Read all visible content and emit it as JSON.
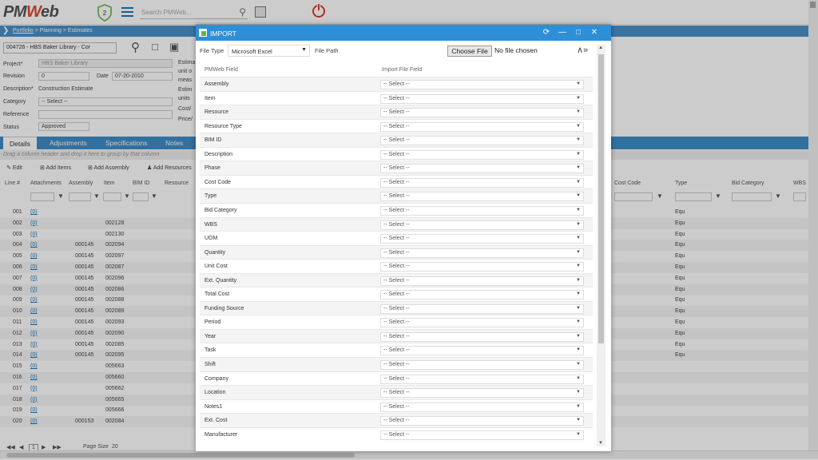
{
  "topbar": {
    "logo_text": "PMWeb",
    "shield_count": "2",
    "search_placeholder": "Search PMWeb..."
  },
  "breadcrumb": {
    "root": "Portfolio",
    "rest": " > Planning > Estimates"
  },
  "record": {
    "selector": "004726 - HBS Baker Library - Cor",
    "fields": [
      {
        "label": "Project*",
        "value": "HBS Baker Library"
      },
      {
        "label": "Revision",
        "value": "0"
      },
      {
        "label": "Date",
        "value": "07-20-2010"
      },
      {
        "label": "Description*",
        "value": "Construction Estimate"
      },
      {
        "label": "Category",
        "value": "-- Select --"
      },
      {
        "label": "Reference",
        "value": ""
      },
      {
        "label": "Status",
        "value": "Approved"
      }
    ],
    "estimate_labels": [
      "Estima",
      "unit o",
      "meas",
      "Estim",
      "units",
      "Cost/",
      "Price/"
    ]
  },
  "tabs": [
    "Details",
    "Adjustments",
    "Specifications",
    "Notes"
  ],
  "group_hint": "Drag a column header and drop it here to group by that column",
  "toolbar": [
    "Edit",
    "Add Items",
    "Add Assembly",
    "Add Resources"
  ],
  "grid": {
    "columns_left": [
      "Line #",
      "Attachments",
      "Assembly",
      "Item",
      "BIM ID",
      "Resource"
    ],
    "columns_right": [
      "Cost Code",
      "Type",
      "Bid Category",
      "WBS"
    ],
    "rows": [
      {
        "line": "001",
        "att": "(0)",
        "asm": "",
        "item": "",
        "type": "Equ"
      },
      {
        "line": "002",
        "att": "(0)",
        "asm": "",
        "item": "002128",
        "type": "Equ"
      },
      {
        "line": "003",
        "att": "(0)",
        "asm": "",
        "item": "002130",
        "type": "Equ"
      },
      {
        "line": "004",
        "att": "(0)",
        "asm": "000145",
        "item": "002094",
        "type": "Equ"
      },
      {
        "line": "005",
        "att": "(0)",
        "asm": "000145",
        "item": "002097",
        "type": "Equ"
      },
      {
        "line": "006",
        "att": "(0)",
        "asm": "000145",
        "item": "002087",
        "type": "Equ"
      },
      {
        "line": "007",
        "att": "(0)",
        "asm": "000145",
        "item": "002096",
        "type": "Equ"
      },
      {
        "line": "008",
        "att": "(0)",
        "asm": "000145",
        "item": "002086",
        "type": "Equ"
      },
      {
        "line": "009",
        "att": "(0)",
        "asm": "000145",
        "item": "002088",
        "type": "Equ"
      },
      {
        "line": "010",
        "att": "(0)",
        "asm": "000145",
        "item": "002089",
        "type": "Equ"
      },
      {
        "line": "011",
        "att": "(0)",
        "asm": "000145",
        "item": "002093",
        "type": "Equ"
      },
      {
        "line": "012",
        "att": "(0)",
        "asm": "000145",
        "item": "002090",
        "type": "Equ"
      },
      {
        "line": "013",
        "att": "(0)",
        "asm": "000145",
        "item": "002085",
        "type": "Equ"
      },
      {
        "line": "014",
        "att": "(0)",
        "asm": "000145",
        "item": "002095",
        "type": "Equ"
      },
      {
        "line": "015",
        "att": "(0)",
        "asm": "",
        "item": "005663",
        "type": ""
      },
      {
        "line": "016",
        "att": "(0)",
        "asm": "",
        "item": "005660",
        "type": ""
      },
      {
        "line": "017",
        "att": "(0)",
        "asm": "",
        "item": "005662",
        "type": ""
      },
      {
        "line": "018",
        "att": "(0)",
        "asm": "",
        "item": "005665",
        "type": ""
      },
      {
        "line": "019",
        "att": "(0)",
        "asm": "",
        "item": "005666",
        "type": ""
      },
      {
        "line": "020",
        "att": "(0)",
        "asm": "000153",
        "item": "002084",
        "type": ""
      }
    ]
  },
  "pager": {
    "page": "1",
    "page_size_label": "Page Size",
    "page_size": "20"
  },
  "modal": {
    "title": "IMPORT",
    "file_type_label": "File Type",
    "file_type_value": "Microsoft Excel",
    "file_path_label": "File Path",
    "choose_file": "Choose File",
    "no_file": "No file chosen",
    "col_pmweb": "PMWeb Field",
    "col_import": "Import File Field",
    "select_placeholder": "-- Select --",
    "fields": [
      "Assembly",
      "Item",
      "Resource",
      "Resource Type",
      "BIM ID",
      "Description",
      "Phase",
      "Cost Code",
      "Type",
      "Bid Category",
      "WBS",
      "UOM",
      "Quantity",
      "Unit Cost",
      "Ext. Quantity",
      "Total Cost",
      "Funding Source",
      "Period",
      "Year",
      "Task",
      "Shift",
      "Company",
      "Location",
      "Notes1",
      "Ext. Cost",
      "Manufacturer"
    ]
  }
}
